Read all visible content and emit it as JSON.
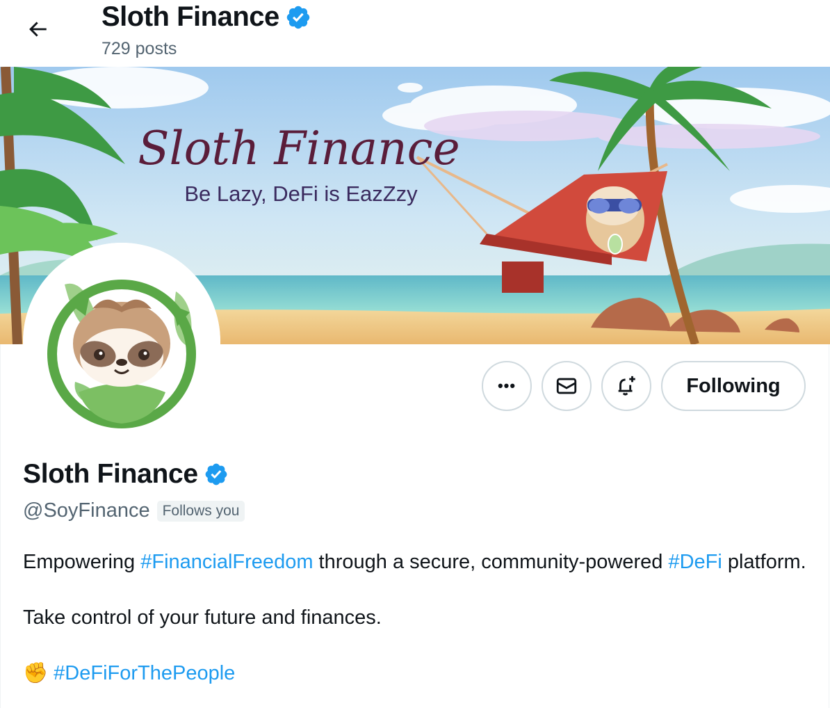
{
  "header": {
    "title": "Sloth Finance",
    "post_count": "729 posts"
  },
  "banner": {
    "headline": "Sloth Finance",
    "tagline": "Be Lazy, DeFi is EazZzy"
  },
  "actions": {
    "more_label": "•••",
    "follow_label": "Following"
  },
  "profile": {
    "name": "Sloth Finance",
    "handle": "@SoyFinance",
    "follows_badge": "Follows you",
    "bio": {
      "line1_a": "Empowering ",
      "line1_tag1": "#FinancialFreedom",
      "line1_b": " through a secure, community-powered ",
      "line1_tag2": "#DeFi",
      "line1_c": " platform.",
      "line2": "Take control of your future and finances.",
      "line3_emoji": "✊",
      "line3_tag": "#DeFiForThePeople"
    }
  },
  "colors": {
    "accent": "#1d9bf0",
    "verified": "#1d9bf0",
    "text_secondary": "#536471"
  },
  "icons": [
    "back-arrow-icon",
    "verified-badge-icon",
    "more-icon",
    "mail-icon",
    "notification-bell-plus-icon"
  ]
}
